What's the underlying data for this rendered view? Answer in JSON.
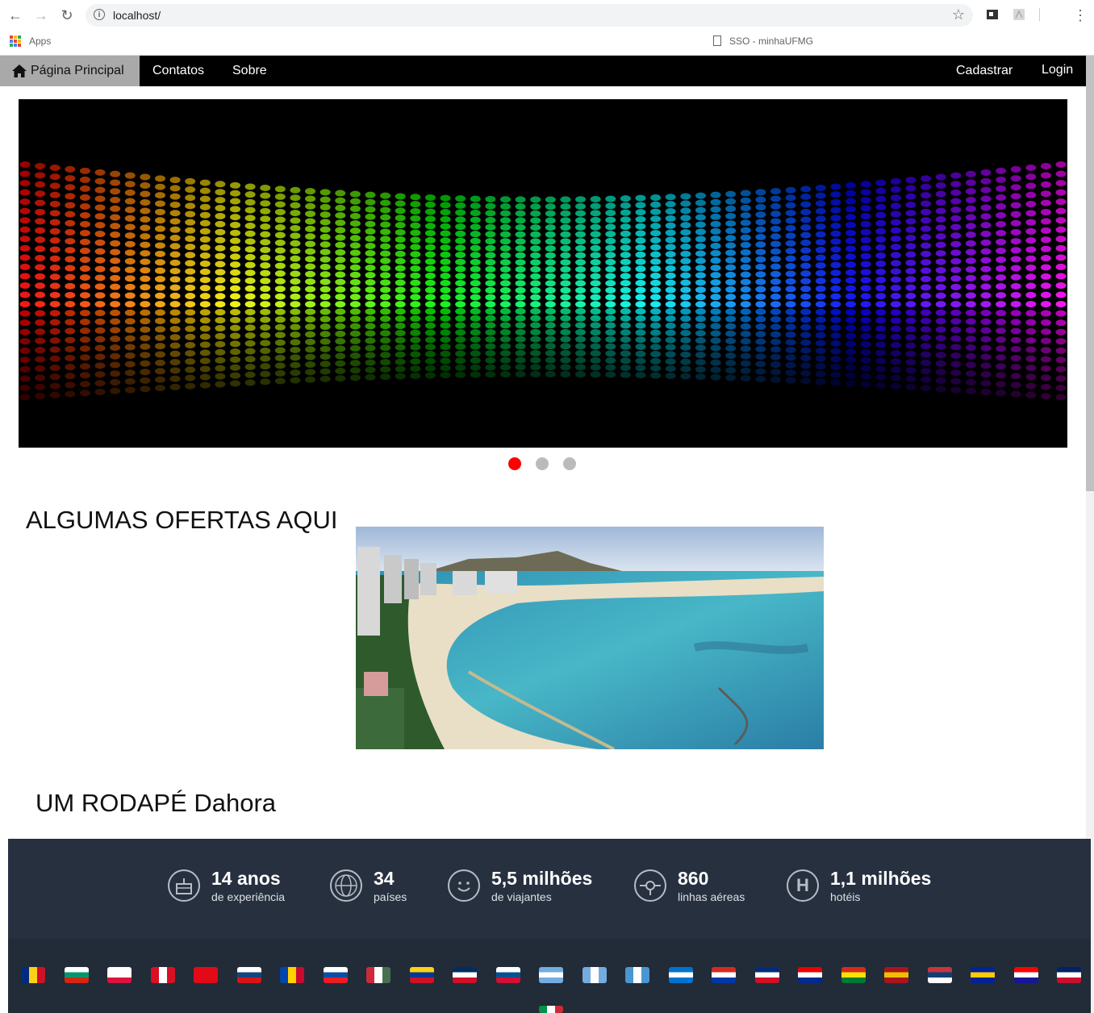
{
  "browser": {
    "url": "localhost/",
    "bookmarks": {
      "apps_label": "Apps",
      "item_label": "SSO - minhaUFMG"
    }
  },
  "navbar": {
    "home_label": "Página Principal",
    "links": [
      "Contatos",
      "Sobre"
    ],
    "right_links": [
      "Cadastrar",
      "Login"
    ]
  },
  "slider": {
    "slide_count": 3,
    "active_index": 0,
    "active_color": "#ff0000",
    "inactive_color": "#bbbbbb"
  },
  "offers": {
    "heading": "ALGUMAS OFERTAS AQUI"
  },
  "footer": {
    "heading": "UM RODAPÉ Dahora",
    "stats": [
      {
        "icon": "cake-icon",
        "value": "14 anos",
        "label": "de experiência"
      },
      {
        "icon": "globe-icon",
        "value": "34",
        "label": "países"
      },
      {
        "icon": "smiley-icon",
        "value": "5,5 milhões",
        "label": "de viajantes"
      },
      {
        "icon": "airline-icon",
        "value": "860",
        "label": "linhas aéreas"
      },
      {
        "icon": "hotel-icon",
        "value": "1,1 milhões",
        "label": "hotéis"
      }
    ],
    "colors": {
      "stats_bg": "#26303f",
      "flags_bg": "#222b38"
    }
  }
}
